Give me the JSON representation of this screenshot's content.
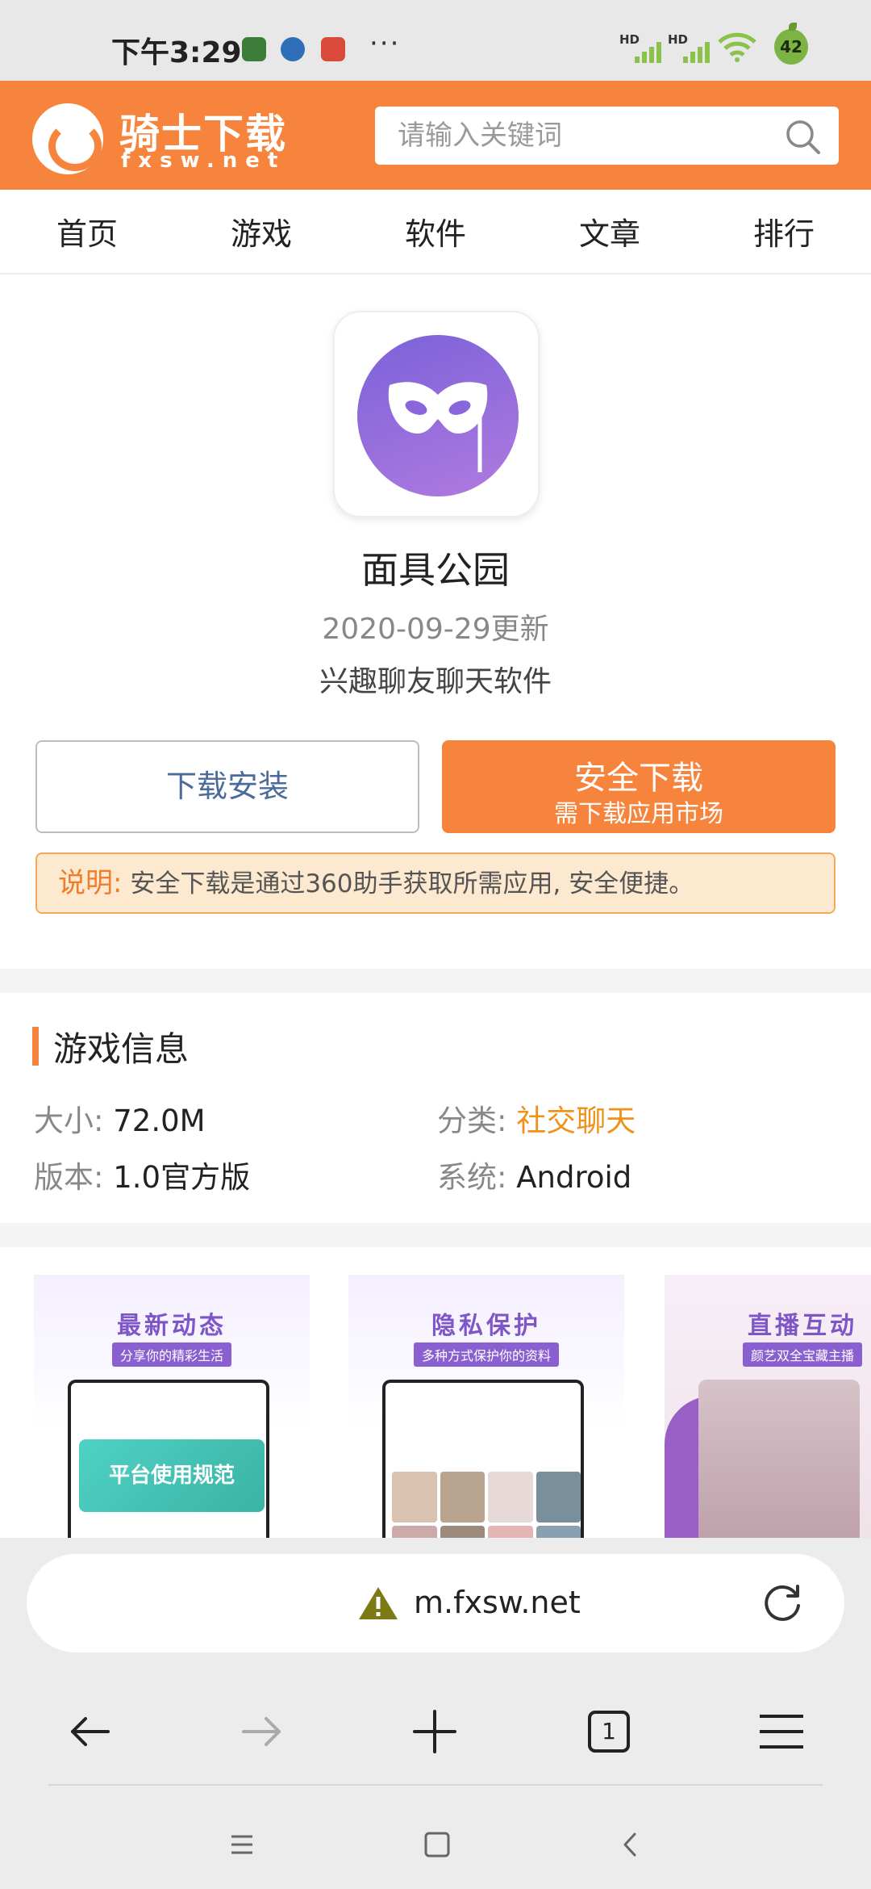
{
  "status": {
    "time": "下午3:29",
    "dots": "···",
    "battery": "42",
    "hd1": "HD",
    "hd2": "HD"
  },
  "header": {
    "logo_title": "骑士下载",
    "logo_sub": "fxsw.net",
    "search_placeholder": "请输入关键词"
  },
  "nav": [
    {
      "label": "首页"
    },
    {
      "label": "游戏"
    },
    {
      "label": "软件"
    },
    {
      "label": "文章"
    },
    {
      "label": "排行"
    }
  ],
  "app": {
    "name": "面具公园",
    "date": "2020-09-29更新",
    "desc": "兴趣聊友聊天软件",
    "install_label": "下载安装",
    "safe_label": "安全下载",
    "safe_sub": "需下载应用市场",
    "notice_label": "说明:",
    "notice_text": " 安全下载是通过360助手获取所需应用, 安全便捷。",
    "icon_color": "#8a66dd"
  },
  "info": {
    "title": "游戏信息",
    "size_label": "大小:",
    "size_value": "72.0M",
    "category_label": "分类:",
    "category_value": "社交聊天",
    "version_label": "版本:",
    "version_value": "1.0官方版",
    "system_label": "系统:",
    "system_value": "Android"
  },
  "screenshots": [
    {
      "title": "最新动态",
      "sub": "分享你的精彩生活",
      "banner": "平台使用规范"
    },
    {
      "title": "隐私保护",
      "sub": "多种方式保护你的资料"
    },
    {
      "title": "直播互动",
      "sub": "颜艺双全宝藏主播"
    }
  ],
  "browser": {
    "url": "m.fxsw.net",
    "tab_count": "1"
  },
  "colors": {
    "brand_orange": "#f7843c",
    "category_orange": "#f0921a"
  }
}
